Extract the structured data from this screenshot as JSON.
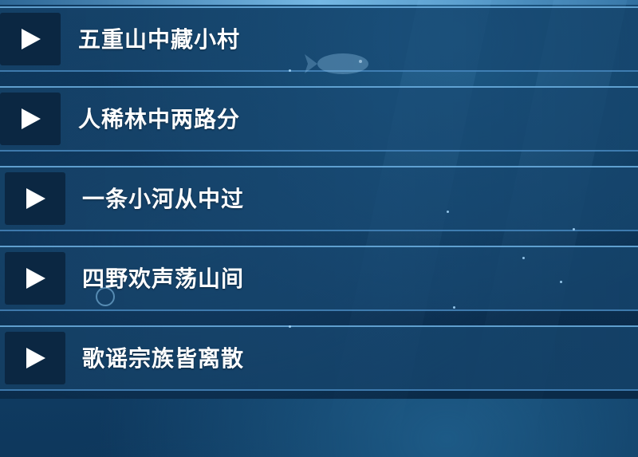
{
  "playlist": {
    "items": [
      {
        "title": "五重山中藏小村",
        "icon": "play-icon"
      },
      {
        "title": "人稀林中两路分",
        "icon": "play-icon"
      },
      {
        "title": "一条小河从中过",
        "icon": "play-icon"
      },
      {
        "title": "四野欢声荡山间",
        "icon": "play-icon"
      },
      {
        "title": "歌谣宗族皆离散",
        "icon": "play-icon"
      }
    ]
  },
  "background": {
    "decoration": "fish-icon",
    "accent_color": "#78bef0",
    "base_color": "#0c3356"
  }
}
